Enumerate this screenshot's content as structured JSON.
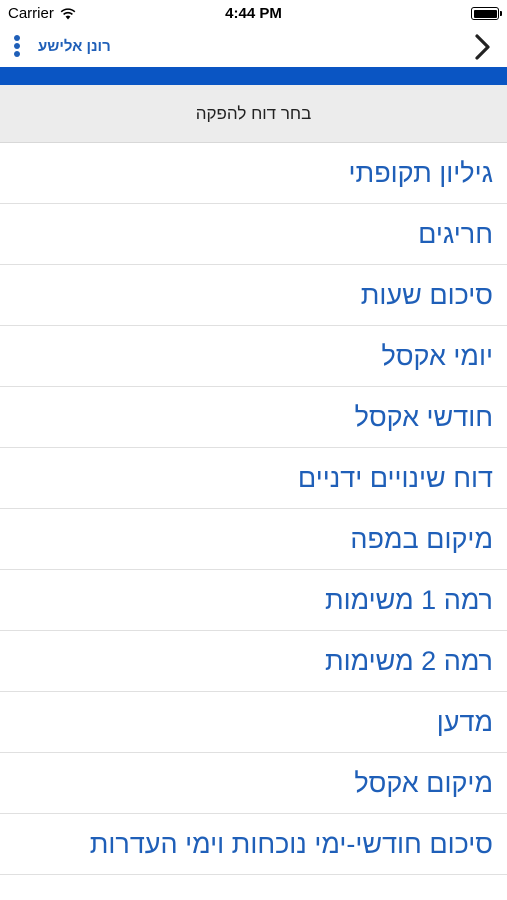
{
  "status_bar": {
    "carrier": "Carrier",
    "time": "4:44 PM",
    "battery_level": 1.0
  },
  "nav_bar": {
    "user_name": "רונן אלישע",
    "menu_icon": "more-vertical-icon",
    "back_icon": "chevron-right-icon"
  },
  "colors": {
    "accent": "#1f5fb8",
    "strip": "#0a55c3",
    "header_bg": "#ececec"
  },
  "header": {
    "title": "בחר דוח להפקה"
  },
  "reports": [
    {
      "label": "גיליון תקופתי"
    },
    {
      "label": "חריגים"
    },
    {
      "label": "סיכום שעות"
    },
    {
      "label": "יומי אקסל"
    },
    {
      "label": "חודשי אקסל"
    },
    {
      "label": "דוח שינויים ידניים"
    },
    {
      "label": "מיקום במפה"
    },
    {
      "label": "רמה 1 משימות"
    },
    {
      "label": "רמה 2 משימות"
    },
    {
      "label": "מדען"
    },
    {
      "label": "מיקום אקסל"
    },
    {
      "label": "סיכום חודשי-ימי נוכחות וימי העדרות"
    }
  ]
}
